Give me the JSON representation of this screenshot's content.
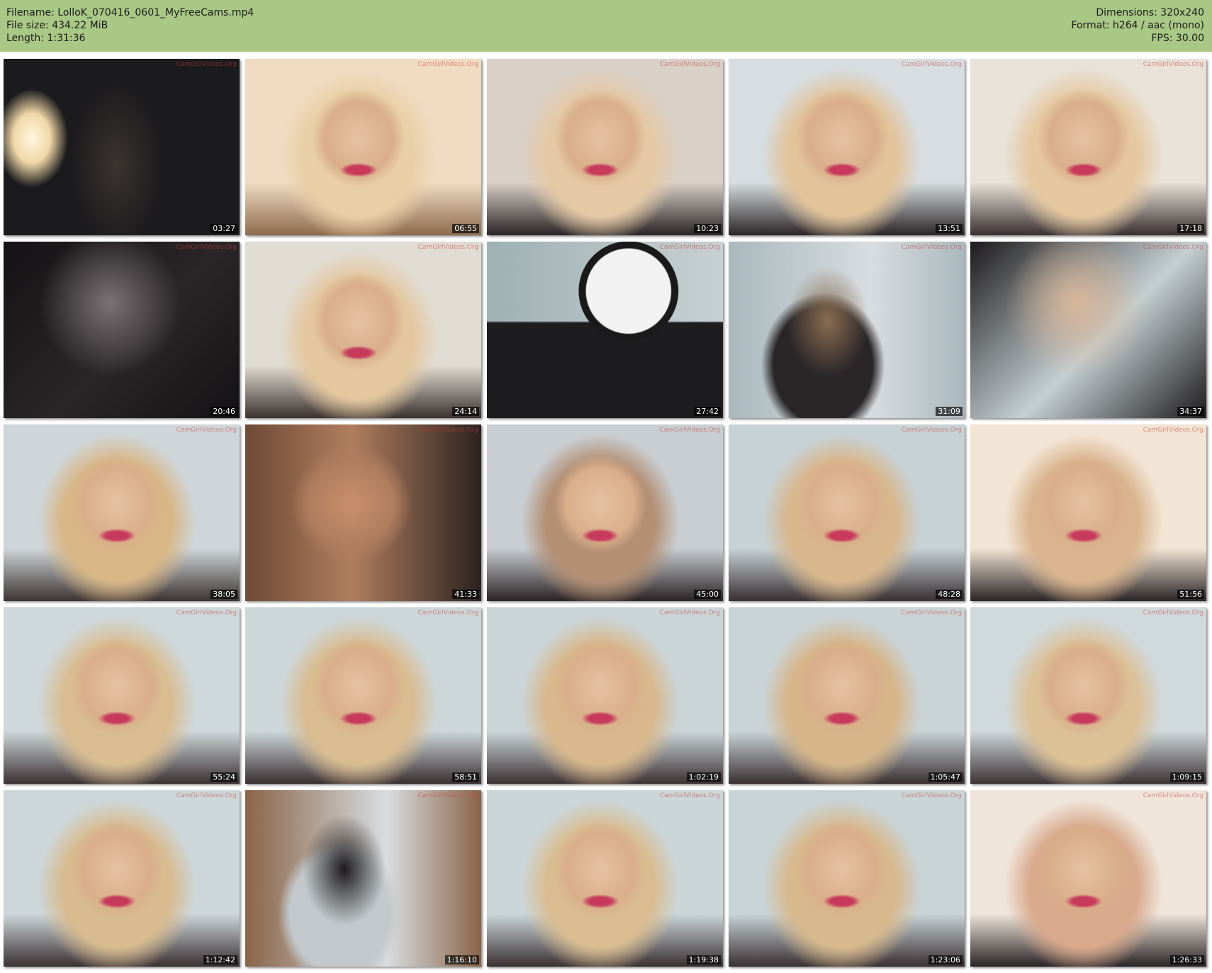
{
  "header": {
    "filename_label": "Filename: LolloK_070416_0601_MyFreeCams.mp4",
    "filesize_label": "File size: 434.22 MiB",
    "length_label": "Length: 1:31:36",
    "dimensions_label": "Dimensions: 320x240",
    "format_label": "Format: h264 / aac (mono)",
    "fps_label": "FPS: 30.00"
  },
  "watermark": "CamGirlVideos.Org",
  "thumbnails": [
    {
      "time": "03:27",
      "scene": "dark-room",
      "colors": [
        "#1b1a1c",
        "#3a3431",
        "#b9a38a"
      ]
    },
    {
      "time": "06:55",
      "scene": "closeup-bright",
      "colors": [
        "#f1dcc3",
        "#e9cfa6",
        "#8c6b4d"
      ]
    },
    {
      "time": "10:23",
      "scene": "closeup",
      "colors": [
        "#d9d0c7",
        "#e5c9a5",
        "#2a2426"
      ]
    },
    {
      "time": "13:51",
      "scene": "closeup",
      "colors": [
        "#d7dde0",
        "#e2c39a",
        "#2b2526"
      ]
    },
    {
      "time": "17:18",
      "scene": "closeup-bright",
      "colors": [
        "#e8e2d8",
        "#e6c8a0",
        "#3a3031"
      ]
    },
    {
      "time": "20:46",
      "scene": "dark-top",
      "colors": [
        "#141214",
        "#2a2628",
        "#7a7375"
      ]
    },
    {
      "time": "24:14",
      "scene": "closeup",
      "colors": [
        "#e1dcd3",
        "#e4c79e",
        "#3b322e"
      ]
    },
    {
      "time": "27:42",
      "scene": "clock",
      "colors": [
        "#9fb1b3",
        "#1d1d1f",
        "#c7d0d2"
      ]
    },
    {
      "time": "31:09",
      "scene": "desk",
      "colors": [
        "#2a2628",
        "#a9b8bd",
        "#8a6d52"
      ]
    },
    {
      "time": "34:37",
      "scene": "dark-top",
      "colors": [
        "#1d1a1c",
        "#c4cfd2",
        "#d9b79a"
      ]
    },
    {
      "time": "38:05",
      "scene": "closeup",
      "colors": [
        "#cfd6d9",
        "#d8b686",
        "#3d3432"
      ]
    },
    {
      "time": "41:33",
      "scene": "closeup-warm",
      "colors": [
        "#b07d5e",
        "#6e4a36",
        "#2c2220"
      ]
    },
    {
      "time": "45:00",
      "scene": "closeup",
      "colors": [
        "#c9ced2",
        "#b38f74",
        "#2a2224"
      ]
    },
    {
      "time": "48:28",
      "scene": "closeup",
      "colors": [
        "#c7d2d6",
        "#d8b78d",
        "#3a3032"
      ]
    },
    {
      "time": "51:56",
      "scene": "closeup-bright",
      "colors": [
        "#f2e5d5",
        "#dab48e",
        "#2b2526"
      ]
    },
    {
      "time": "55:24",
      "scene": "closeup",
      "colors": [
        "#cfd8db",
        "#d9bd91",
        "#3b3133"
      ]
    },
    {
      "time": "58:51",
      "scene": "closeup",
      "colors": [
        "#cdd7da",
        "#d9bc90",
        "#3a3032"
      ]
    },
    {
      "time": "1:02:19",
      "scene": "closeup",
      "colors": [
        "#cbd5d8",
        "#d8b88c",
        "#3c3234"
      ]
    },
    {
      "time": "1:05:47",
      "scene": "closeup",
      "colors": [
        "#cad4d7",
        "#d6b589",
        "#3b3133"
      ]
    },
    {
      "time": "1:09:15",
      "scene": "closeup",
      "colors": [
        "#d0d9dc",
        "#dcc096",
        "#3d3335"
      ]
    },
    {
      "time": "1:12:42",
      "scene": "closeup",
      "colors": [
        "#cdd7da",
        "#d8bb8f",
        "#3a3032"
      ]
    },
    {
      "time": "1:16:10",
      "scene": "desk-wide",
      "colors": [
        "#c2c8cb",
        "#8a6448",
        "#1e1b1d"
      ]
    },
    {
      "time": "1:19:38",
      "scene": "closeup",
      "colors": [
        "#cbd6d9",
        "#d9bd91",
        "#3b3133"
      ]
    },
    {
      "time": "1:23:06",
      "scene": "closeup",
      "colors": [
        "#c9d4d7",
        "#d8b98d",
        "#3a3032"
      ]
    },
    {
      "time": "1:26:33",
      "scene": "closeup-bright",
      "colors": [
        "#efe5db",
        "#d9a98c",
        "#2a2426"
      ]
    }
  ]
}
